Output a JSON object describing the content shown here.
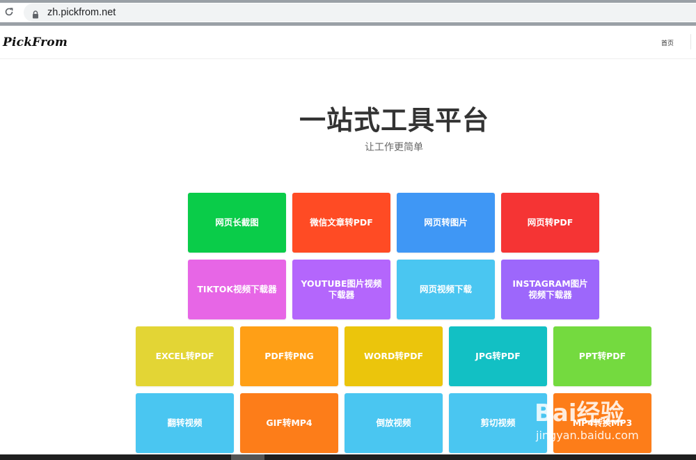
{
  "browser": {
    "url": "zh.pickfrom.net"
  },
  "nav": {
    "logo": "PickFrom",
    "home": "首页"
  },
  "hero": {
    "title": "一站式工具平台",
    "subtitle": "让工作更简单"
  },
  "tiles": [
    {
      "label": "网页长截图",
      "color": "#0acc49"
    },
    {
      "label": "微信文章转PDF",
      "color": "#ff4b24"
    },
    {
      "label": "网页转图片",
      "color": "#3f97f5"
    },
    {
      "label": "网页转PDF",
      "color": "#f53434"
    },
    {
      "label": "TIKTOK视频下载器",
      "color": "#e766e6"
    },
    {
      "label": "YOUTUBE图片视频下载器",
      "color": "#b466fc"
    },
    {
      "label": "网页视频下载",
      "color": "#4ac6f1"
    },
    {
      "label": "INSTAGRAM图片视频下载器",
      "color": "#9d67fb"
    },
    {
      "label": "EXCEL转PDF",
      "color": "#e3d535"
    },
    {
      "label": "PDF转PNG",
      "color": "#ff9f16"
    },
    {
      "label": "WORD转PDF",
      "color": "#ebc50c"
    },
    {
      "label": "JPG转PDF",
      "color": "#12c0c4"
    },
    {
      "label": "PPT转PDF",
      "color": "#74da3f"
    },
    {
      "label": "翻转视频",
      "color": "#4ac6f1"
    },
    {
      "label": "GIF转MP4",
      "color": "#fd7d19"
    },
    {
      "label": "倒放视频",
      "color": "#4ac6f1"
    },
    {
      "label": "剪切视频",
      "color": "#4ac6f1"
    },
    {
      "label": "MP4转换MP3",
      "color": "#fd7d19"
    }
  ],
  "watermark": {
    "brand": "Bai经验",
    "domain": "jingyan.baidu.com"
  }
}
